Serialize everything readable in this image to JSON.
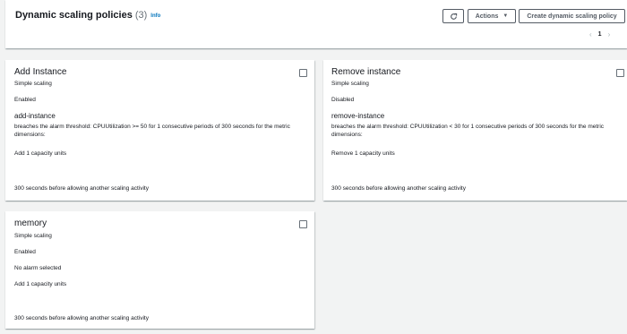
{
  "header": {
    "title": "Dynamic scaling policies",
    "count": "(3)",
    "info_label": "Info",
    "refresh_icon": "refresh-icon",
    "actions_label": "Actions",
    "create_label": "Create dynamic scaling policy",
    "pagination": {
      "current_page": "1"
    }
  },
  "policies": [
    {
      "name": "Add Instance",
      "type": "Simple scaling",
      "status": "Enabled",
      "alarm_name": "add-instance",
      "alarm_desc": "breaches the alarm threshold: CPUUtilization >= 50 for 1 consecutive periods of 300 seconds for the metric dimensions:",
      "action": "Add 1 capacity units",
      "cooldown": "300 seconds before allowing another scaling activity"
    },
    {
      "name": "Remove instance",
      "type": "Simple scaling",
      "status": "Disabled",
      "alarm_name": "remove-instance",
      "alarm_desc": "breaches the alarm threshold: CPUUtilization < 30 for 1 consecutive periods of 300 seconds for the metric dimensions:",
      "action": "Remove 1 capacity units",
      "cooldown": "300 seconds before allowing another scaling activity"
    },
    {
      "name": "memory",
      "type": "Simple scaling",
      "status": "Enabled",
      "alarm_text": "No alarm selected",
      "action": "Add 1 capacity units",
      "cooldown": "300 seconds before allowing another scaling activity"
    }
  ]
}
